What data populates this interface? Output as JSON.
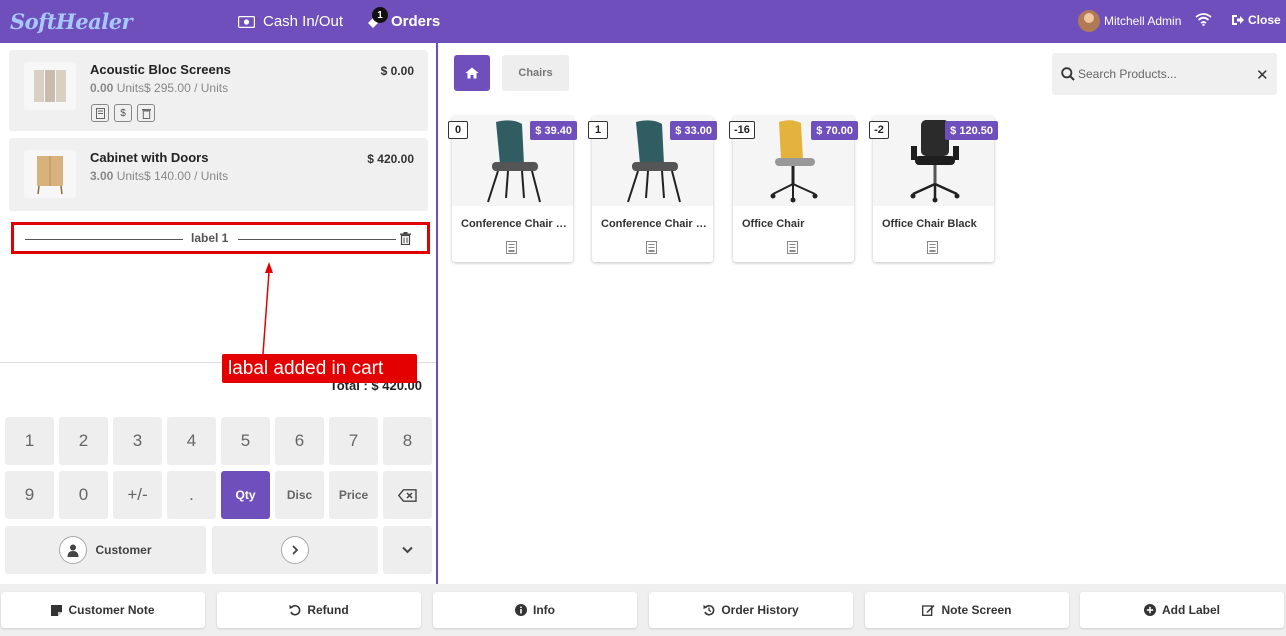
{
  "header": {
    "logo": "SoftHealer",
    "cash_label": "Cash In/Out",
    "orders_label": "Orders",
    "orders_badge": "1",
    "user_name": "Mitchell Admin",
    "close_label": "Close"
  },
  "order_lines": [
    {
      "name": "Acoustic Bloc Screens",
      "qty": "0.00",
      "unit_detail": "Units$ 295.00 / Units",
      "price": "$ 0.00"
    },
    {
      "name": "Cabinet with Doors",
      "qty": "3.00",
      "unit_detail": "Units$ 140.00 / Units",
      "price": "$ 420.00"
    }
  ],
  "label_line": {
    "text": "label 1"
  },
  "total": "Total : $ 420.00",
  "annotation": "labal  added in cart",
  "numpad": {
    "row1": [
      "1",
      "2",
      "3",
      "4",
      "5",
      "6",
      "7",
      "8"
    ],
    "row2": [
      "9",
      "0",
      "+/-",
      ".",
      "Qty",
      "Disc",
      "Price"
    ],
    "customer_label": "Customer"
  },
  "category": {
    "breadcrumb": "Chairs"
  },
  "search": {
    "placeholder": "Search Products...",
    "value": ""
  },
  "products": [
    {
      "qty": "0",
      "price": "$ 39.40",
      "name": "Conference Chair (Aluminium)"
    },
    {
      "qty": "1",
      "price": "$ 33.00",
      "name": "Conference Chair (Steel)"
    },
    {
      "qty": "-16",
      "price": "$ 70.00",
      "name": "Office Chair"
    },
    {
      "qty": "-2",
      "price": "$ 120.50",
      "name": "Office Chair Black"
    }
  ],
  "bottom_buttons": {
    "customer_note": "Customer Note",
    "refund": "Refund",
    "info": "Info",
    "order_history": "Order History",
    "note_screen": "Note Screen",
    "add_label": "Add Label"
  },
  "colors": {
    "primary": "#6f4fbc",
    "annotation": "#e40000"
  }
}
